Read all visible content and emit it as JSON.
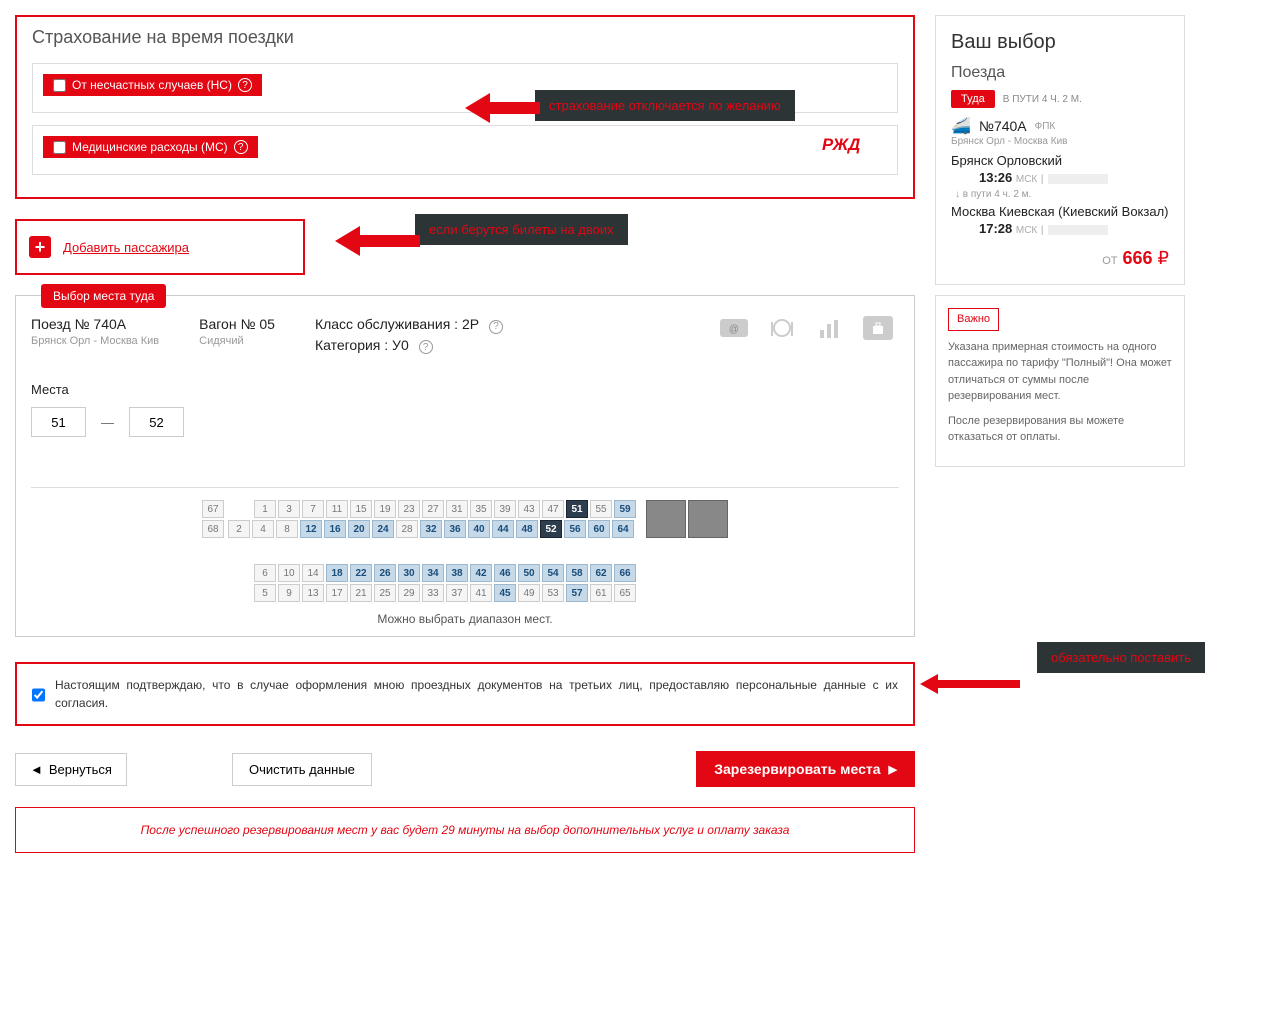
{
  "insurance": {
    "title": "Страхование на время поездки",
    "accident_label": "От несчастных случаев (НС)",
    "medical_label": "Медицинские расходы (МС)"
  },
  "annotations": {
    "insurance_off": "страхование отключается по желанию",
    "tickets_two": "если берутся билеты на двоих",
    "must_check": "обязательно поставить"
  },
  "add_passenger": "Добавить пассажира",
  "seat": {
    "tab": "Выбор места туда",
    "train_label": "Поезд № 740А",
    "route": "Брянск Орл - Москва Кив",
    "wagon_label": "Вагон № 05",
    "wagon_type": "Сидячий",
    "class_label": "Класс обслуживания : 2Р",
    "category_label": "Категория : У0",
    "seats_label": "Места",
    "seat_from": "51",
    "seat_to": "52",
    "range_note": "Можно выбрать диапазон мест."
  },
  "seatmap": {
    "row1_left": [
      "67"
    ],
    "row2_left": [
      "68"
    ],
    "row1": [
      {
        "n": "1"
      },
      {
        "n": "3"
      },
      {
        "n": "7"
      },
      {
        "n": "11"
      },
      {
        "n": "15"
      },
      {
        "n": "19"
      },
      {
        "n": "23"
      },
      {
        "n": "27"
      },
      {
        "n": "31"
      },
      {
        "n": "35"
      },
      {
        "n": "39"
      },
      {
        "n": "43"
      },
      {
        "n": "47"
      },
      {
        "n": "51",
        "s": "selected"
      },
      {
        "n": "55"
      },
      {
        "n": "59",
        "s": "avail"
      }
    ],
    "row2": [
      {
        "n": "2"
      },
      {
        "n": "4"
      },
      {
        "n": "8"
      },
      {
        "n": "12",
        "s": "avail"
      },
      {
        "n": "16",
        "s": "avail"
      },
      {
        "n": "20",
        "s": "avail"
      },
      {
        "n": "24",
        "s": "avail"
      },
      {
        "n": "28"
      },
      {
        "n": "32",
        "s": "avail"
      },
      {
        "n": "36",
        "s": "avail"
      },
      {
        "n": "40",
        "s": "avail"
      },
      {
        "n": "44",
        "s": "avail"
      },
      {
        "n": "48",
        "s": "avail"
      },
      {
        "n": "52",
        "s": "selected"
      },
      {
        "n": "56",
        "s": "avail"
      },
      {
        "n": "60",
        "s": "avail"
      },
      {
        "n": "64",
        "s": "avail"
      }
    ],
    "row3": [
      {
        "n": "6"
      },
      {
        "n": "10"
      },
      {
        "n": "14"
      },
      {
        "n": "18",
        "s": "avail"
      },
      {
        "n": "22",
        "s": "avail"
      },
      {
        "n": "26",
        "s": "avail"
      },
      {
        "n": "30",
        "s": "avail"
      },
      {
        "n": "34",
        "s": "avail"
      },
      {
        "n": "38",
        "s": "avail"
      },
      {
        "n": "42",
        "s": "avail"
      },
      {
        "n": "46",
        "s": "avail"
      },
      {
        "n": "50",
        "s": "avail"
      },
      {
        "n": "54",
        "s": "avail"
      },
      {
        "n": "58",
        "s": "avail"
      },
      {
        "n": "62",
        "s": "avail"
      },
      {
        "n": "66",
        "s": "avail"
      }
    ],
    "row4": [
      {
        "n": "5"
      },
      {
        "n": "9"
      },
      {
        "n": "13"
      },
      {
        "n": "17"
      },
      {
        "n": "21"
      },
      {
        "n": "25"
      },
      {
        "n": "29"
      },
      {
        "n": "33"
      },
      {
        "n": "37"
      },
      {
        "n": "41"
      },
      {
        "n": "45",
        "s": "avail"
      },
      {
        "n": "49"
      },
      {
        "n": "53"
      },
      {
        "n": "57",
        "s": "avail"
      },
      {
        "n": "61"
      },
      {
        "n": "65"
      }
    ]
  },
  "consent": "Настоящим подтверждаю, что в случае оформления мною проездных документов на третьих лиц, предоставляю персональные данные с их согласия.",
  "buttons": {
    "back": "Вернуться",
    "clear": "Очистить данные",
    "reserve": "Зарезервировать места"
  },
  "timer_notice": "После успешного резервирования мест у вас будет 29 минуты на выбор дополнительных услуг и оплату заказа",
  "sidebar": {
    "title": "Ваш выбор",
    "trains": "Поезда",
    "direction": "Туда",
    "travel_time": "В ПУТИ 4 Ч. 2 М.",
    "train_no": "№740А",
    "carrier": "ФПК",
    "route": "Брянск Орл - Москва Кив",
    "from_station": "Брянск Орловский",
    "from_time": "13:26",
    "tz": "МСК",
    "transit": "в пути  4 ч. 2 м.",
    "to_station": "Москва Киевская (Киевский Вокзал)",
    "to_time": "17:28",
    "price_from": "ОТ",
    "price": "666",
    "currency": "₽",
    "note_badge": "Важно",
    "note1": "Указана примерная стоимость на одного пассажира по тарифу \"Полный\"! Она может отличаться от суммы после резервирования мест.",
    "note2": "После резервирования вы можете отказаться от оплаты."
  }
}
